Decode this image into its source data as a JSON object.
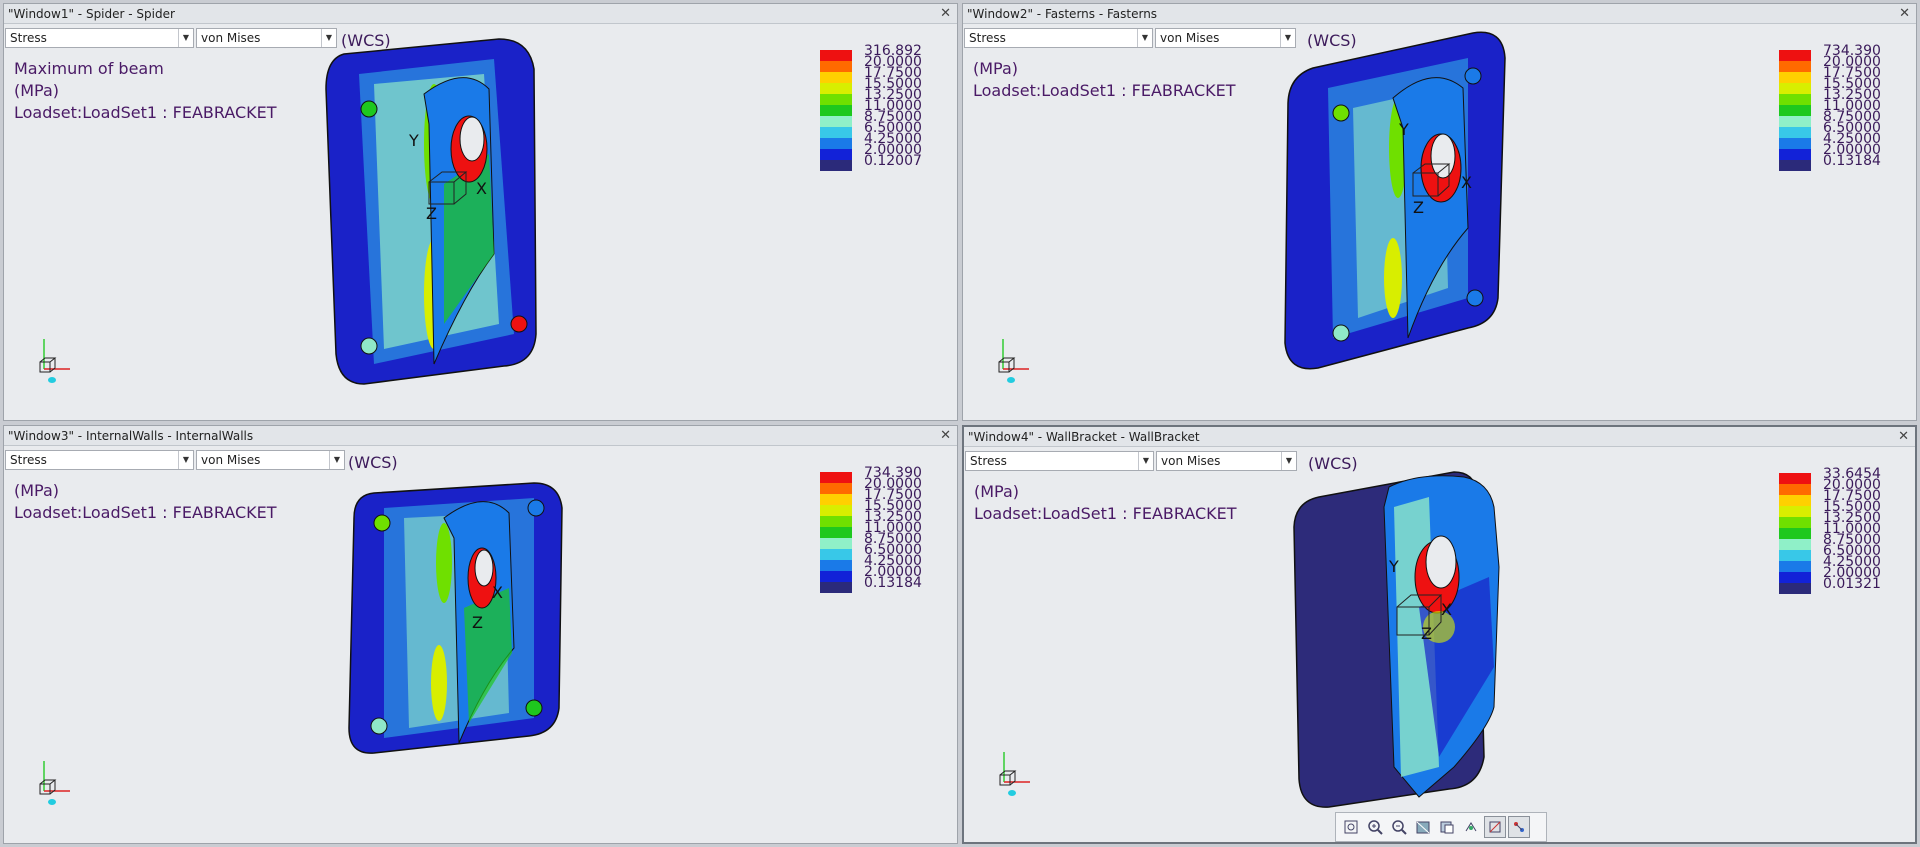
{
  "windows": [
    {
      "title": "\"Window1\" - Spider - Spider",
      "result_type": "Stress",
      "component": "von Mises",
      "wcs": "(WCS)",
      "info": [
        "Maximum of beam",
        "(MPa)",
        "Loadset:LoadSet1 :  FEABRACKET"
      ],
      "legend": [
        "316.892",
        "20.0000",
        "17.7500",
        "15.5000",
        "13.2500",
        "11.0000",
        "8.75000",
        "6.50000",
        "4.25000",
        "2.00000",
        "0.12007"
      ]
    },
    {
      "title": "\"Window2\" - Fasterns - Fasterns",
      "result_type": "Stress",
      "component": "von Mises",
      "wcs": "(WCS)",
      "info": [
        "(MPa)",
        "Loadset:LoadSet1 :  FEABRACKET"
      ],
      "legend": [
        "734.390",
        "20.0000",
        "17.7500",
        "15.5000",
        "13.2500",
        "11.0000",
        "8.75000",
        "6.50000",
        "4.25000",
        "2.00000",
        "0.13184"
      ]
    },
    {
      "title": "\"Window3\" - InternalWalls - InternalWalls",
      "result_type": "Stress",
      "component": "von Mises",
      "wcs": "(WCS)",
      "info": [
        "(MPa)",
        "Loadset:LoadSet1 :  FEABRACKET"
      ],
      "legend": [
        "734.390",
        "20.0000",
        "17.7500",
        "15.5000",
        "13.2500",
        "11.0000",
        "8.75000",
        "6.50000",
        "4.25000",
        "2.00000",
        "0.13184"
      ]
    },
    {
      "title": "\"Window4\" - WallBracket - WallBracket",
      "result_type": "Stress",
      "component": "von Mises",
      "wcs": "(WCS)",
      "info": [
        "(MPa)",
        "Loadset:LoadSet1 :  FEABRACKET"
      ],
      "legend": [
        "33.6454",
        "20.0000",
        "17.7500",
        "15.5000",
        "13.2500",
        "11.0000",
        "8.75000",
        "6.50000",
        "4.25000",
        "2.00000",
        "0.01321"
      ]
    }
  ],
  "legend_colors": [
    "#ee1111",
    "#ff6a00",
    "#ffd000",
    "#d8ee00",
    "#6fe000",
    "#1ec81e",
    "#8ff0c8",
    "#38c8e8",
    "#1a7ae8",
    "#1222d8",
    "#2b2a7a"
  ],
  "axis_labels": {
    "y": "Y",
    "x": "X",
    "z": "Z"
  },
  "toolbar": {
    "icons": [
      "refit-icon",
      "zoom-in-icon",
      "zoom-out-icon",
      "shading-icon",
      "saved-views-icon",
      "spin-center-icon",
      "datum-display-icon",
      "annotation-display-icon"
    ]
  }
}
